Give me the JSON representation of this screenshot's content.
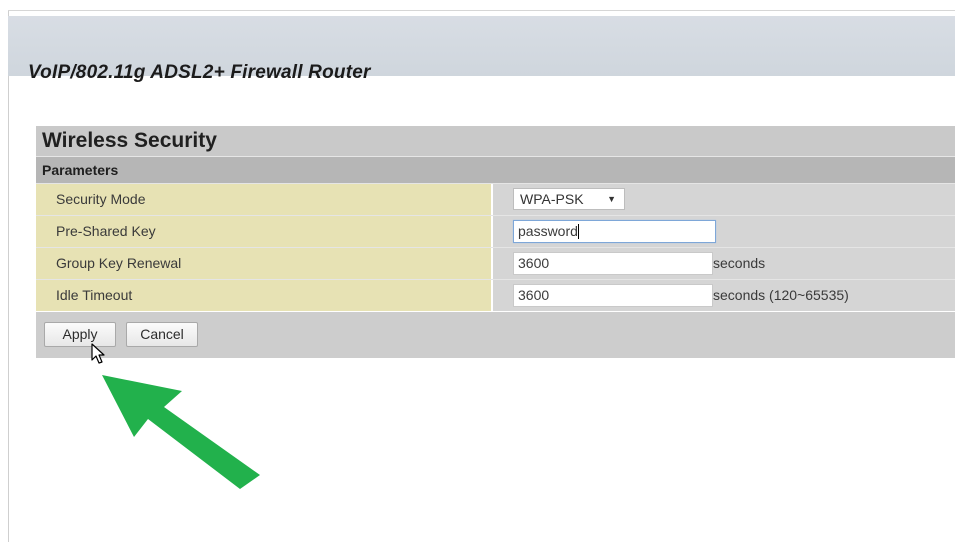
{
  "header": {
    "title": "VoIP/802.11g ADSL2+ Firewall Router"
  },
  "panel": {
    "title": "Wireless Security",
    "subheader": "Parameters",
    "rows": [
      {
        "label": "Security Mode",
        "control": "select",
        "value": "WPA-PSK"
      },
      {
        "label": "Pre-Shared Key",
        "control": "input",
        "value": "password"
      },
      {
        "label": "Group Key Renewal",
        "control": "input",
        "value": "3600",
        "suffix": "seconds"
      },
      {
        "label": "Idle Timeout",
        "control": "input",
        "value": "3600",
        "suffix": "seconds (120~65535)"
      }
    ]
  },
  "buttons": {
    "apply": "Apply",
    "cancel": "Cancel"
  },
  "icons": {
    "cursor": "mouse-pointer-icon",
    "annotation": "green-arrow-icon",
    "dropdown": "triangle-down-icon"
  },
  "colors": {
    "label_bg": "#e7e2b4",
    "value_bg": "#d5d5d5",
    "arrow": "#22b14c"
  }
}
